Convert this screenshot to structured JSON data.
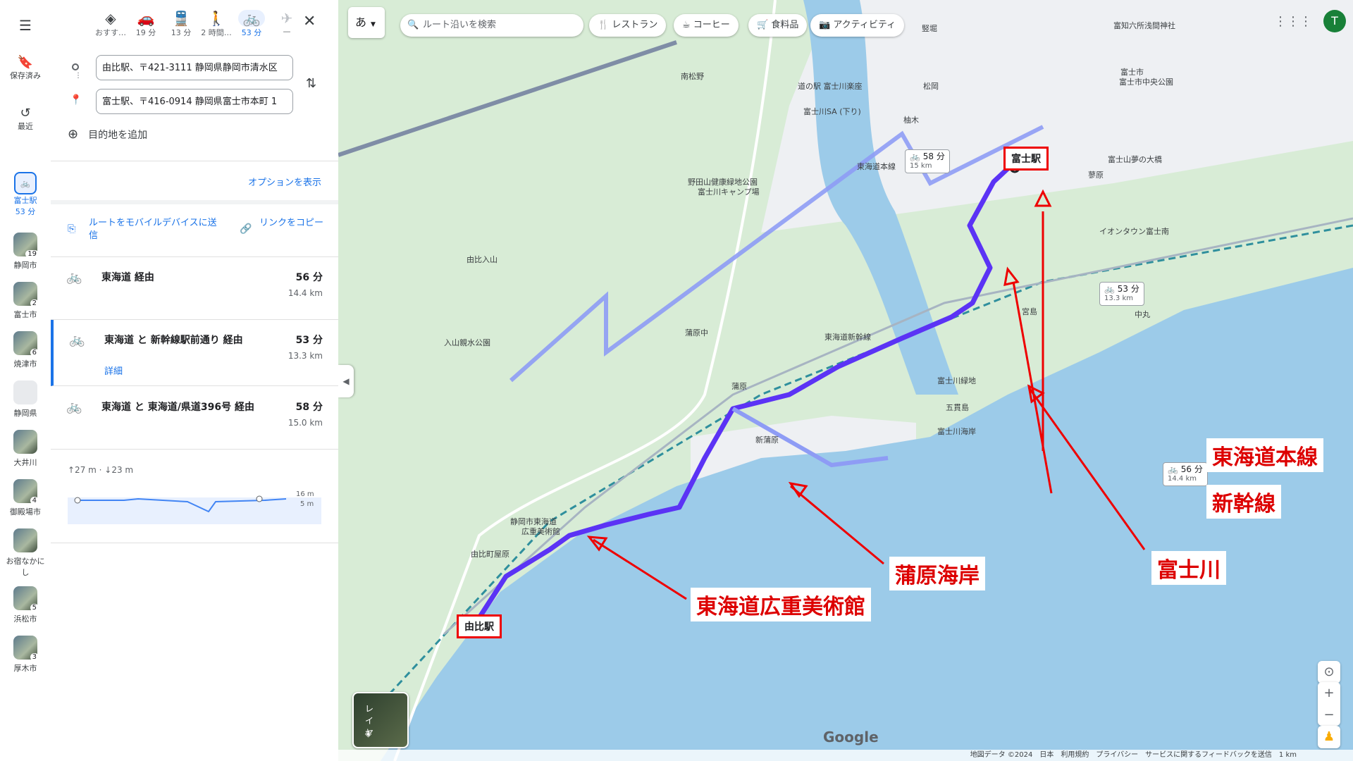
{
  "rail": {
    "saved": "保存済み",
    "recent": "最近",
    "active_trip": {
      "name": "富士駅",
      "time": "53 分"
    },
    "items": [
      {
        "label": "静岡市",
        "count": "19"
      },
      {
        "label": "富士市",
        "count": "2"
      },
      {
        "label": "焼津市",
        "count": "6"
      },
      {
        "label": "静岡県",
        "count": ""
      },
      {
        "label": "大井川",
        "count": ""
      },
      {
        "label": "御殿場市",
        "count": "4"
      },
      {
        "label": "お宿なかにし",
        "count": ""
      },
      {
        "label": "浜松市",
        "count": "5"
      },
      {
        "label": "厚木市",
        "count": "3"
      }
    ]
  },
  "modes": [
    {
      "label": "おすす…",
      "icon": "diamond-icon"
    },
    {
      "label": "19 分",
      "icon": "car-icon"
    },
    {
      "label": "13 分",
      "icon": "train-icon"
    },
    {
      "label": "2 時間…",
      "icon": "walk-icon"
    },
    {
      "label": "53 分",
      "icon": "bike-icon"
    },
    {
      "label": "—",
      "icon": "plane-icon"
    }
  ],
  "origin": "由比駅、〒421-3111 静岡県静岡市清水区",
  "destination": "富士駅、〒416-0914 静岡県富士市本町 1",
  "add_destination": "目的地を追加",
  "options": "オプションを表示",
  "send_to_mobile": "ルートをモバイルデバイスに送信",
  "copy_link": "リンクをコピー",
  "routes": [
    {
      "name": "東海道 経由",
      "time": "56 分",
      "distance": "14.4 km",
      "detail": ""
    },
    {
      "name": "東海道 と 新幹線駅前通り 経由",
      "time": "53 分",
      "distance": "13.3 km",
      "detail": "詳細"
    },
    {
      "name": "東海道 と 東海道/県道396号 経由",
      "time": "58 分",
      "distance": "15.0 km",
      "detail": ""
    }
  ],
  "elevation": {
    "summary": "↑27 m · ↓23 m",
    "max_label": "16 m",
    "min_label": "5 m"
  },
  "map": {
    "lang_button": "あ",
    "search_placeholder": "ルート沿いを検索",
    "chips": [
      "レストラン",
      "コーヒー",
      "食料品",
      "アクティビティ"
    ],
    "layer_label": "レイヤ",
    "avatar": "T",
    "footer": "地図データ ©2024　日本　利用規約　プライバシー　サービスに関するフィードバックを送信　1 km",
    "google": "Google",
    "place_labels": [
      "南松野",
      "野田山健康緑地公園",
      "富士川キャンプ場",
      "由比入山",
      "入山親水公園",
      "蒲原中",
      "蒲原",
      "新蒲原",
      "静岡市東海道",
      "広重美術館",
      "由比町屋原",
      "富士川緑地",
      "五貫島",
      "富士川海岸",
      "富士市中央公園",
      "富士山夢の大橋",
      "イオンタウン富士南",
      "道の駅 富士川楽座",
      "富士川SA (下り)",
      "柚木",
      "松岡",
      "東海道新幹線",
      "東海道本線",
      "富士市",
      "蓼原",
      "宮島",
      "中丸",
      "富知六所浅間神社",
      "竪堀"
    ],
    "route_boxes": [
      {
        "time": "58 分",
        "dist": "15 km"
      },
      {
        "time": "53 分",
        "dist": "13.3 km"
      },
      {
        "time": "56 分",
        "dist": "14.4 km"
      }
    ],
    "start_station": "由比駅",
    "end_station": "富士駅",
    "annotations": [
      "東海道本線",
      "新幹線",
      "富士川",
      "蒲原海岸",
      "東海道広重美術館"
    ]
  },
  "colors": {
    "route": "#5b33f5",
    "alt_route": "#8e9cf5",
    "annotation": "#dd0000",
    "sea": "#9ccbe9",
    "land": "#d8ecd6"
  }
}
